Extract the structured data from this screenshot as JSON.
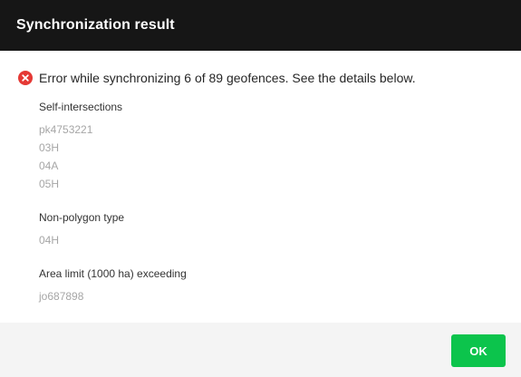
{
  "dialog": {
    "title": "Synchronization result"
  },
  "error": {
    "icon": "error-circle-icon",
    "color": "#e53935",
    "message": "Error while synchronizing 6 of 89 geofences. See the details below."
  },
  "groups": [
    {
      "title": "Self-intersections",
      "items": [
        "pk4753221",
        "03H",
        "04A",
        "05H"
      ]
    },
    {
      "title": "Non-polygon type",
      "items": [
        "04H"
      ]
    },
    {
      "title": "Area limit (1000 ha) exceeding",
      "items": [
        "jo687898"
      ]
    }
  ],
  "footer": {
    "ok_label": "OK",
    "ok_color": "#0cc44c"
  }
}
